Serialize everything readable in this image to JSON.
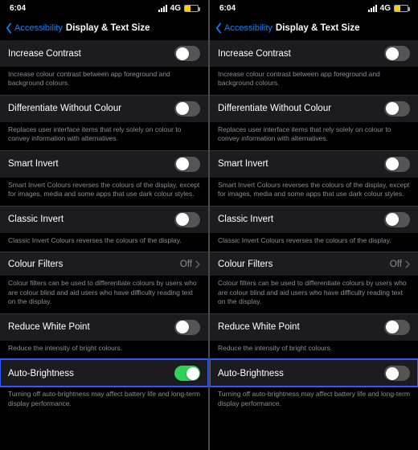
{
  "status": {
    "time": "6:04",
    "network": "4G"
  },
  "nav": {
    "back": "Accessibility",
    "title": "Display & Text Size"
  },
  "labels": {
    "increase_contrast": "Increase Contrast",
    "differentiate": "Differentiate Without Colour",
    "smart_invert": "Smart Invert",
    "classic_invert": "Classic Invert",
    "colour_filters": "Colour Filters",
    "reduce_white": "Reduce White Point",
    "auto_brightness": "Auto-Brightness"
  },
  "values": {
    "colour_filters": "Off"
  },
  "desc": {
    "increase_contrast": "Increase colour contrast between app foreground and background colours.",
    "differentiate": "Replaces user interface items that rely solely on colour to convey information with alternatives.",
    "smart_invert": "Smart Invert Colours reverses the colours of the display, except for images, media and some apps that use dark colour styles.",
    "classic_invert": "Classic Invert Colours reverses the colours of the display.",
    "colour_filters": "Colour filters can be used to differentiate colours by users who are colour blind and aid users who have difficulty reading text on the display.",
    "reduce_white": "Reduce the intensity of bright colours.",
    "auto_brightness": "Turning off auto-brightness may affect battery life and long-term display performance."
  },
  "left": {
    "auto_brightness_on": true
  },
  "right": {
    "auto_brightness_on": false
  }
}
